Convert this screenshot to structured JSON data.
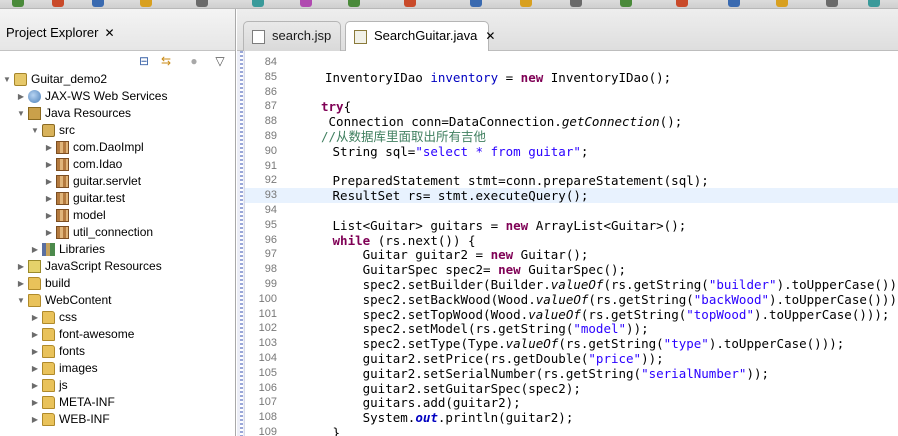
{
  "explorer": {
    "tab_label": "Project Explorer",
    "tab_close": "✕",
    "tree": [
      {
        "label": "Guitar_demo2",
        "icon": "project-icon",
        "depth": 0,
        "expanded": true
      },
      {
        "label": "JAX-WS Web Services",
        "icon": "webservice-icon",
        "depth": 1,
        "expanded": false
      },
      {
        "label": "Java Resources",
        "icon": "java-resources-icon",
        "depth": 1,
        "expanded": true
      },
      {
        "label": "src",
        "icon": "source-folder-icon",
        "depth": 2,
        "expanded": true
      },
      {
        "label": "com.DaoImpl",
        "icon": "package-icon",
        "depth": 3,
        "expanded": false
      },
      {
        "label": "com.Idao",
        "icon": "package-icon",
        "depth": 3,
        "expanded": false
      },
      {
        "label": "guitar.servlet",
        "icon": "package-icon",
        "depth": 3,
        "expanded": false
      },
      {
        "label": "guitar.test",
        "icon": "package-icon",
        "depth": 3,
        "expanded": false
      },
      {
        "label": "model",
        "icon": "package-icon",
        "depth": 3,
        "expanded": false
      },
      {
        "label": "util_connection",
        "icon": "package-icon",
        "depth": 3,
        "expanded": false
      },
      {
        "label": "Libraries",
        "icon": "library-icon",
        "depth": 2,
        "expanded": false
      },
      {
        "label": "JavaScript Resources",
        "icon": "javascript-resources-icon",
        "depth": 1,
        "expanded": false
      },
      {
        "label": "build",
        "icon": "folder-icon",
        "depth": 1,
        "expanded": false
      },
      {
        "label": "WebContent",
        "icon": "folder-icon",
        "depth": 1,
        "expanded": true
      },
      {
        "label": "css",
        "icon": "folder-icon",
        "depth": 2,
        "expanded": false
      },
      {
        "label": "font-awesome",
        "icon": "folder-icon",
        "depth": 2,
        "expanded": false
      },
      {
        "label": "fonts",
        "icon": "folder-icon",
        "depth": 2,
        "expanded": false
      },
      {
        "label": "images",
        "icon": "folder-icon",
        "depth": 2,
        "expanded": false
      },
      {
        "label": "js",
        "icon": "folder-icon",
        "depth": 2,
        "expanded": false
      },
      {
        "label": "META-INF",
        "icon": "folder-icon",
        "depth": 2,
        "expanded": false
      },
      {
        "label": "WEB-INF",
        "icon": "folder-icon",
        "depth": 2,
        "expanded": false
      }
    ]
  },
  "editor": {
    "tabs": [
      {
        "label": "search.jsp",
        "active": false
      },
      {
        "label": "SearchGuitar.java",
        "active": true
      }
    ],
    "tab_close": "✕",
    "highlighted_line": "93",
    "lines": [
      {
        "n": "84",
        "parts": []
      },
      {
        "n": "85",
        "parts": [
          [
            "",
            "InventoryIDao "
          ],
          [
            "fld",
            "inventory"
          ],
          [
            "",
            " = "
          ],
          [
            "kw",
            "new"
          ],
          [
            "",
            " InventoryIDao();"
          ]
        ]
      },
      {
        "n": "86",
        "parts": []
      },
      {
        "n": "87",
        "parts": [
          [
            "kw",
            "try"
          ],
          [
            "",
            "{"
          ]
        ]
      },
      {
        "n": "88",
        "parts": [
          [
            "",
            " Connection conn=DataConnection."
          ],
          [
            "it",
            "getConnection"
          ],
          [
            "",
            "();"
          ]
        ]
      },
      {
        "n": "89",
        "parts": [
          [
            "cm",
            "//从数据库里面取出所有吉他"
          ]
        ]
      },
      {
        "n": "90",
        "parts": [
          [
            "",
            " String sql="
          ],
          [
            "str",
            "\"select * from guitar\""
          ],
          [
            "",
            ";"
          ]
        ]
      },
      {
        "n": "91",
        "parts": []
      },
      {
        "n": "92",
        "parts": [
          [
            "",
            " PreparedStatement stmt=conn.prepareStatement(sql);"
          ]
        ]
      },
      {
        "n": "93",
        "parts": [
          [
            "",
            " ResultSet rs= stmt.executeQuery();"
          ]
        ]
      },
      {
        "n": "94",
        "parts": []
      },
      {
        "n": "95",
        "parts": [
          [
            "",
            " List<Guitar> guitars = "
          ],
          [
            "kw",
            "new"
          ],
          [
            "",
            " ArrayList<Guitar>();"
          ]
        ]
      },
      {
        "n": "96",
        "parts": [
          [
            "",
            " "
          ],
          [
            "kw",
            "while"
          ],
          [
            "",
            " (rs.next()) {"
          ]
        ]
      },
      {
        "n": "97",
        "parts": [
          [
            "",
            "     Guitar guitar2 = "
          ],
          [
            "kw",
            "new"
          ],
          [
            "",
            " Guitar();"
          ]
        ]
      },
      {
        "n": "98",
        "parts": [
          [
            "",
            "     GuitarSpec spec2= "
          ],
          [
            "kw",
            "new"
          ],
          [
            "",
            " GuitarSpec();"
          ]
        ]
      },
      {
        "n": "99",
        "parts": [
          [
            "",
            "     spec2.setBuilder(Builder."
          ],
          [
            "it",
            "valueOf"
          ],
          [
            "",
            "(rs.getString("
          ],
          [
            "str",
            "\"builder\""
          ],
          [
            "",
            ").toUpperCase())"
          ]
        ]
      },
      {
        "n": "100",
        "parts": [
          [
            "",
            "     spec2.setBackWood(Wood."
          ],
          [
            "it",
            "valueOf"
          ],
          [
            "",
            "(rs.getString("
          ],
          [
            "str",
            "\"backWood\""
          ],
          [
            "",
            ").toUpperCase()))"
          ]
        ]
      },
      {
        "n": "101",
        "parts": [
          [
            "",
            "     spec2.setTopWood(Wood."
          ],
          [
            "it",
            "valueOf"
          ],
          [
            "",
            "(rs.getString("
          ],
          [
            "str",
            "\"topWood\""
          ],
          [
            "",
            ").toUpperCase()));"
          ]
        ]
      },
      {
        "n": "102",
        "parts": [
          [
            "",
            "     spec2.setModel(rs.getString("
          ],
          [
            "str",
            "\"model\""
          ],
          [
            "",
            "));"
          ]
        ]
      },
      {
        "n": "103",
        "parts": [
          [
            "",
            "     spec2.setType(Type."
          ],
          [
            "it",
            "valueOf"
          ],
          [
            "",
            "(rs.getString("
          ],
          [
            "str",
            "\"type\""
          ],
          [
            "",
            ").toUpperCase()));"
          ]
        ]
      },
      {
        "n": "104",
        "parts": [
          [
            "",
            "     guitar2.setPrice(rs.getDouble("
          ],
          [
            "str",
            "\"price\""
          ],
          [
            "",
            "));"
          ]
        ]
      },
      {
        "n": "105",
        "parts": [
          [
            "",
            "     guitar2.setSerialNumber(rs.getString("
          ],
          [
            "str",
            "\"serialNumber\""
          ],
          [
            "",
            "));"
          ]
        ]
      },
      {
        "n": "106",
        "parts": [
          [
            "",
            "     guitar2.setGuitarSpec(spec2);"
          ]
        ]
      },
      {
        "n": "107",
        "parts": [
          [
            "",
            "     guitars.add(guitar2);"
          ]
        ]
      },
      {
        "n": "108",
        "parts": [
          [
            "",
            "     System."
          ],
          [
            "st",
            "out"
          ],
          [
            "",
            ".println(guitar2);"
          ]
        ]
      },
      {
        "n": "109",
        "parts": [
          [
            "",
            " }"
          ]
        ]
      }
    ]
  },
  "colors": {
    "keyword": "#7f0055",
    "string": "#2a00ff",
    "comment": "#3f7f5f",
    "field": "#0000c0",
    "current_line": "#e8f2fe"
  }
}
